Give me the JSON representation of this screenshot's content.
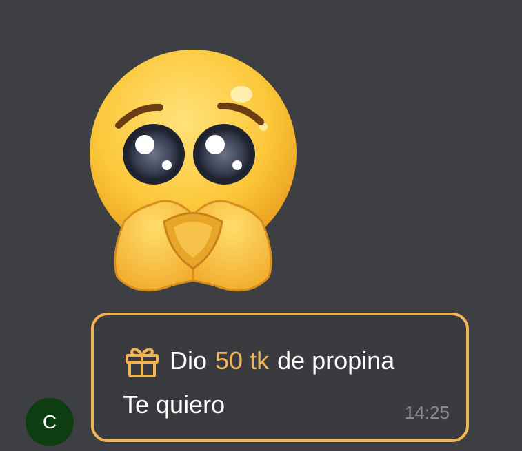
{
  "sticker": {
    "icon": "pleading-face-heart-hands-icon"
  },
  "avatar": {
    "initial": "C",
    "color": "#0f3d12"
  },
  "message": {
    "tip_prefix": "Dio",
    "tip_amount": "50 tk",
    "tip_suffix": "de propina",
    "text": "Te quiero",
    "time": "14:25",
    "gift_icon": "gift-icon",
    "accent_color": "#f2b454"
  }
}
